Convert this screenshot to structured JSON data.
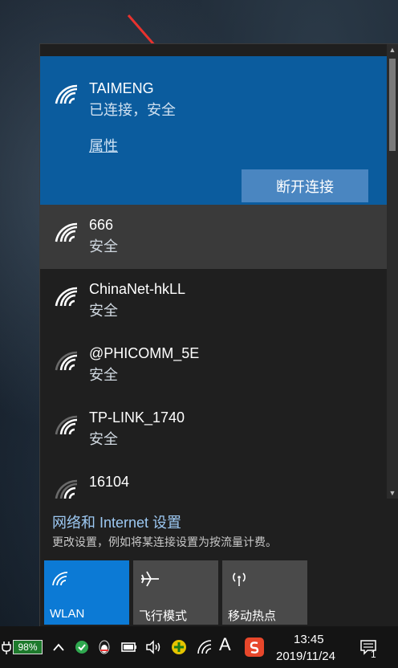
{
  "connected_network": {
    "ssid": "TAIMENG",
    "status": "已连接，安全",
    "properties_label": "属性",
    "disconnect_label": "断开连接"
  },
  "networks": [
    {
      "ssid": "666",
      "security": "安全"
    },
    {
      "ssid": "ChinaNet-hkLL",
      "security": "安全"
    },
    {
      "ssid": "@PHICOMM_5E",
      "security": "安全"
    },
    {
      "ssid": "TP-LINK_1740",
      "security": "安全"
    },
    {
      "ssid": "16104",
      "security": ""
    }
  ],
  "settings": {
    "link_label": "网络和 Internet 设置",
    "description": "更改设置，例如将某连接设置为按流量计费。"
  },
  "quick_actions": [
    {
      "label": "WLAN",
      "icon": "wifi-icon",
      "active": true
    },
    {
      "label": "飞行模式",
      "icon": "airplane-icon",
      "active": false
    },
    {
      "label": "移动热点",
      "icon": "hotspot-icon",
      "active": false
    }
  ],
  "taskbar": {
    "battery_percent": "98%",
    "font_indicator": "A",
    "clock_time": "13:45",
    "clock_date": "2019/11/24",
    "notification_count": "1"
  },
  "colors": {
    "accent": "#0c7ad5",
    "connected_bg": "#0b5c9e",
    "flyout_bg": "#1f1f1f",
    "annotation_arrow": "#e8322e"
  }
}
